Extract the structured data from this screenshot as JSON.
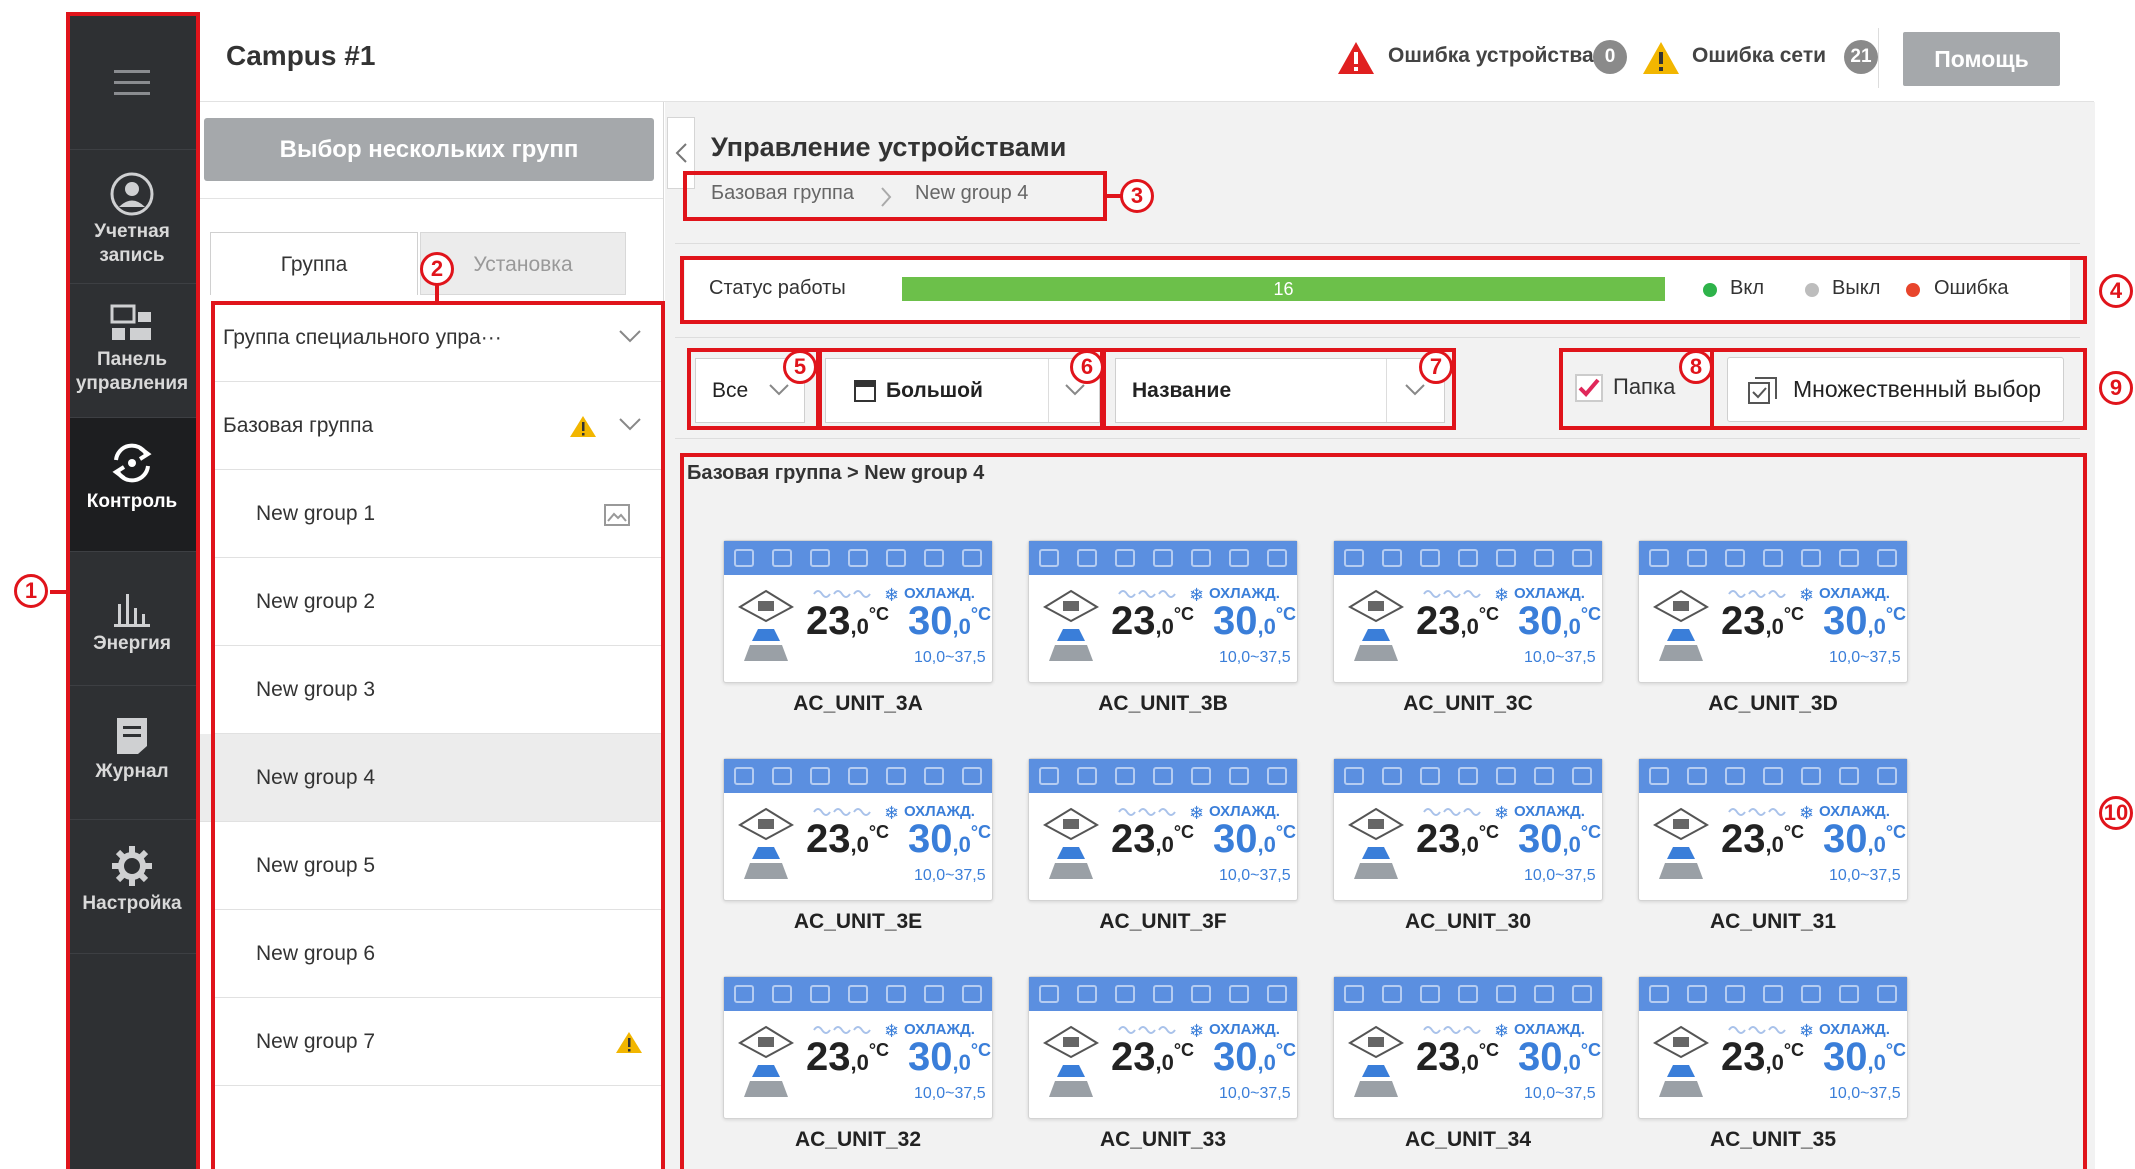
{
  "sidebar": {
    "items": [
      {
        "label": "Учетная запись",
        "icon": "account-icon"
      },
      {
        "label": "Панель управления",
        "icon": "dashboard-icon"
      },
      {
        "label": "Контроль",
        "icon": "control-icon"
      },
      {
        "label": "Энергия",
        "icon": "energy-chart-icon"
      },
      {
        "label": "Журнал",
        "icon": "log-icon"
      },
      {
        "label": "Настройка",
        "icon": "gear-icon"
      }
    ],
    "active": "Контроль"
  },
  "header": {
    "title": "Campus #1",
    "device_error_label": "Ошибка устройства",
    "device_error_count": "0",
    "network_error_label": "Ошибка сети",
    "network_error_count": "21",
    "help_label": "Помощь"
  },
  "left_panel": {
    "multi_select_label": "Выбор нескольких групп",
    "tabs": [
      {
        "label": "Группа",
        "active": true
      },
      {
        "label": "Установка",
        "active": false
      }
    ],
    "tree": [
      {
        "label": "Группа специального упра···",
        "level": 0,
        "expand": true
      },
      {
        "label": "Базовая группа",
        "level": 0,
        "warning": true,
        "expand": true
      },
      {
        "label": "New group 1",
        "level": 1,
        "icon": "image-icon"
      },
      {
        "label": "New group 2",
        "level": 1
      },
      {
        "label": "New group 3",
        "level": 1
      },
      {
        "label": "New group 4",
        "level": 1,
        "selected": true
      },
      {
        "label": "New group 5",
        "level": 1
      },
      {
        "label": "New group 6",
        "level": 1
      },
      {
        "label": "New group 7",
        "level": 1,
        "warning": true
      }
    ]
  },
  "main": {
    "title": "Управление устройствами",
    "breadcrumb": [
      "Базовая группа",
      "New group 4"
    ],
    "status": {
      "label": "Статус работы",
      "on_count": "16",
      "on_fraction": 1.0,
      "legend": [
        {
          "label": "Вкл",
          "color": "#2eb34a"
        },
        {
          "label": "Выкл",
          "color": "#bdbdbd"
        },
        {
          "label": "Ошибка",
          "color": "#e8452c"
        }
      ]
    },
    "filters": {
      "all_label": "Все",
      "size_label": "Большой",
      "sort_label": "Название",
      "folder_label": "Папка",
      "folder_checked": true,
      "multiselect_label": "Множественный выбор"
    },
    "group_path": "Базовая группа > New group 4",
    "devices": [
      {
        "name": "AC_UNIT_3A"
      },
      {
        "name": "AC_UNIT_3B"
      },
      {
        "name": "AC_UNIT_3C"
      },
      {
        "name": "AC_UNIT_3D"
      },
      {
        "name": "AC_UNIT_3E"
      },
      {
        "name": "AC_UNIT_3F"
      },
      {
        "name": "AC_UNIT_30"
      },
      {
        "name": "AC_UNIT_31"
      },
      {
        "name": "AC_UNIT_32"
      },
      {
        "name": "AC_UNIT_33"
      },
      {
        "name": "AC_UNIT_34"
      },
      {
        "name": "AC_UNIT_35"
      }
    ],
    "device_common": {
      "mode": "ОХЛАЖД.",
      "current_int": "23",
      "current_dec": ",0",
      "set_int": "30",
      "set_dec": ",0",
      "unit": "°C",
      "range": "10,0~37,5"
    }
  },
  "annotations": [
    "1",
    "2",
    "3",
    "4",
    "5",
    "6",
    "7",
    "8",
    "9",
    "10"
  ],
  "colors": {
    "accent_red": "#e0141b",
    "status_green": "#6cc04a",
    "card_blue": "#5b8fe0"
  }
}
